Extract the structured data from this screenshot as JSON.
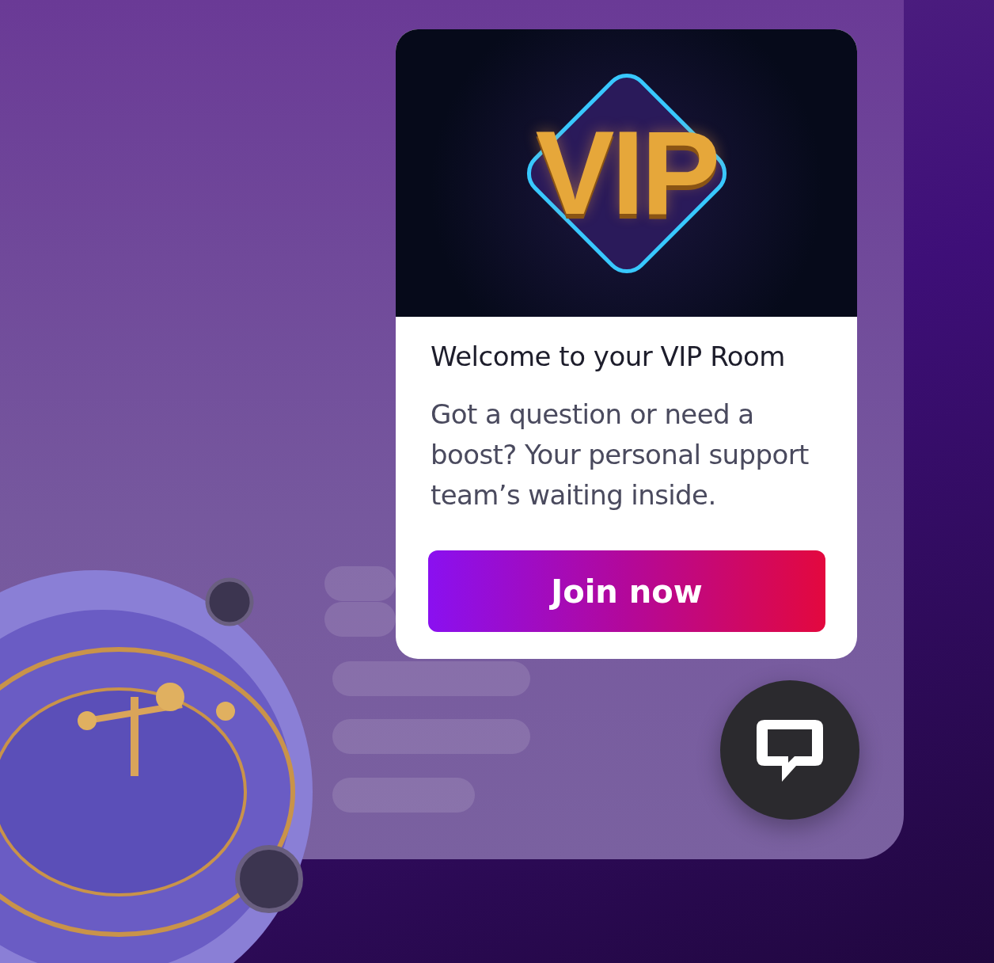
{
  "banner": {
    "logo_text": "VIP"
  },
  "card": {
    "title": "Welcome to your VIP Room",
    "body": "Got a question or need a boost? Your personal support team’s waiting inside.",
    "button": "Join now"
  }
}
